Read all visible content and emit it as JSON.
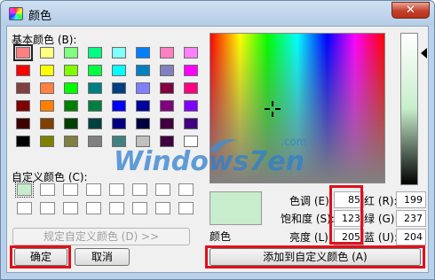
{
  "window": {
    "title": "颜色",
    "close_glyph": "✕"
  },
  "basic_colors": {
    "label": "基本颜色 (B):",
    "rows": [
      [
        "#ff8080",
        "#ffff80",
        "#80ff80",
        "#00ff80",
        "#80ffff",
        "#0080ff",
        "#ff80c0",
        "#ff80ff"
      ],
      [
        "#ff0000",
        "#ffff00",
        "#80ff00",
        "#00ff40",
        "#00ffff",
        "#0080c0",
        "#8080c0",
        "#ff00ff"
      ],
      [
        "#804040",
        "#ff8040",
        "#00ff00",
        "#008080",
        "#004080",
        "#8080ff",
        "#800040",
        "#ff0080"
      ],
      [
        "#800000",
        "#ff8000",
        "#008000",
        "#008040",
        "#0000ff",
        "#0000a0",
        "#800080",
        "#8000ff"
      ],
      [
        "#400000",
        "#804000",
        "#004000",
        "#004040",
        "#000080",
        "#000040",
        "#400040",
        "#400080"
      ],
      [
        "#000000",
        "#808000",
        "#808040",
        "#808080",
        "#408080",
        "#c0c0c0",
        "#400040",
        "#ffffff"
      ]
    ]
  },
  "custom_colors": {
    "label": "自定义颜色 (C):",
    "filled_color": "#c7edcc"
  },
  "buttons": {
    "define_custom": "规定自定义颜色 (D) >>",
    "ok": "确定",
    "cancel": "取消",
    "add_custom": "添加到自定义颜色 (A)"
  },
  "preview_label": "颜色",
  "fields": {
    "hue": {
      "label": "色调 (E):",
      "value": "85"
    },
    "sat": {
      "label": "饱和度 (S):",
      "value": "123"
    },
    "lum": {
      "label": "亮度 (L):",
      "value": "205"
    },
    "red": {
      "label": "红 (R):",
      "value": "199"
    },
    "green": {
      "label": "绿 (G):",
      "value": "237"
    },
    "blue": {
      "label": "蓝 (U):",
      "value": "204"
    }
  },
  "current_color": "#c7edcc",
  "highlight_color": "#e0101a",
  "watermark": {
    "brand": "Windows7en",
    "domain": ".com"
  }
}
